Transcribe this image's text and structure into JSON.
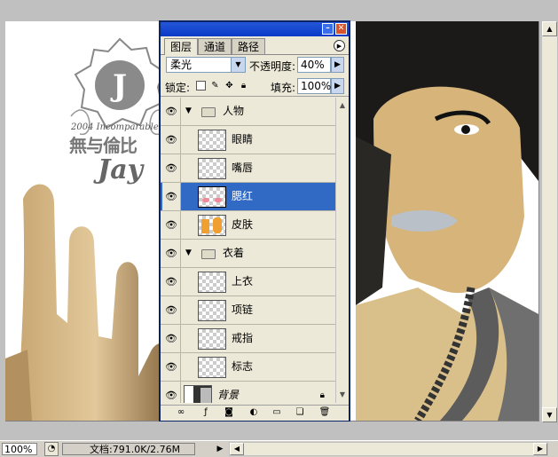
{
  "status": {
    "zoom": "100%",
    "document": "文档:791.0K/2.76M"
  },
  "canvas": {
    "logo_year": "2004 Incomparable",
    "logo_text": "無与倫比",
    "logo_name": "Jay"
  },
  "palette": {
    "tabs": [
      {
        "label": "图层",
        "active": true
      },
      {
        "label": "通道",
        "active": false
      },
      {
        "label": "路径",
        "active": false
      }
    ],
    "blend_mode": "柔光",
    "opacity_label": "不透明度:",
    "opacity_value": "40%",
    "lock_label": "锁定:",
    "fill_label": "填充:",
    "fill_value": "100%",
    "layers": [
      {
        "name": "人物",
        "type": "group",
        "visible": true,
        "selected": false
      },
      {
        "name": "眼睛",
        "type": "layer",
        "visible": true,
        "selected": false
      },
      {
        "name": "嘴唇",
        "type": "layer",
        "visible": true,
        "selected": false
      },
      {
        "name": "腮红",
        "type": "layer",
        "visible": true,
        "selected": true
      },
      {
        "name": "皮肤",
        "type": "layer",
        "visible": true,
        "selected": false
      },
      {
        "name": "衣着",
        "type": "group",
        "visible": true,
        "selected": false
      },
      {
        "name": "上衣",
        "type": "layer",
        "visible": true,
        "selected": false
      },
      {
        "name": "项链",
        "type": "layer",
        "visible": true,
        "selected": false
      },
      {
        "name": "戒指",
        "type": "layer",
        "visible": true,
        "selected": false
      },
      {
        "name": "标志",
        "type": "layer",
        "visible": true,
        "selected": false
      },
      {
        "name": "背景",
        "type": "background",
        "visible": true,
        "selected": false,
        "locked": true
      }
    ]
  },
  "colors": {
    "selection": "#316ac5",
    "titlebar": "#0a3ac8",
    "panel": "#ece9d8"
  }
}
